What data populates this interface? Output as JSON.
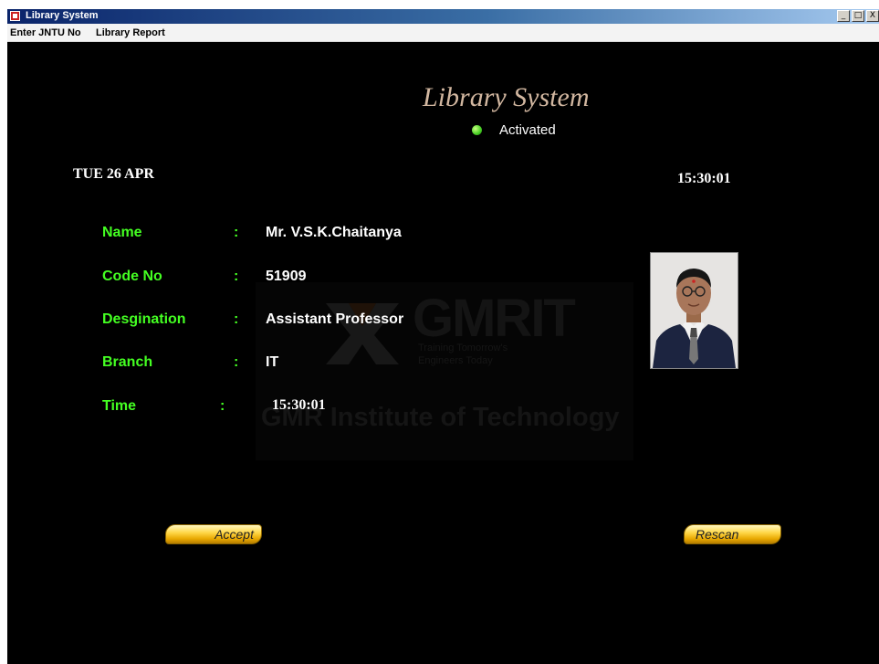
{
  "window": {
    "title": "Library System",
    "controls": {
      "minimize": "_",
      "maximize": "□",
      "close": "X"
    }
  },
  "menu": {
    "items": [
      "Enter JNTU No",
      "Library Report"
    ]
  },
  "header": {
    "title": "Library System",
    "status": {
      "label": "Activated",
      "color": "#44cc22"
    }
  },
  "date": "TUE 26 APR",
  "clock": "15:30:01",
  "fields": [
    {
      "label": "Name",
      "value": "Mr. V.S.K.Chaitanya"
    },
    {
      "label": "Code No",
      "value": "51909"
    },
    {
      "label": "Desgination",
      "value": "Assistant Professor"
    },
    {
      "label": "Branch",
      "value": "IT"
    },
    {
      "label": "Time",
      "value": "15:30:01"
    }
  ],
  "separator": ":",
  "watermark": {
    "brand": "GMRIT",
    "tagline": [
      "Training Tomorrow's",
      "Engineers Today"
    ],
    "institution": "GMR Institute of Technology"
  },
  "photo": {
    "icon": "person-photo"
  },
  "buttons": {
    "accept": "Accept",
    "rescan": "Rescan"
  },
  "colors": {
    "background": "#000000",
    "label": "#44ff22",
    "value": "#ffffff",
    "title": "#d2b7a0",
    "button": "#ffd84a"
  }
}
